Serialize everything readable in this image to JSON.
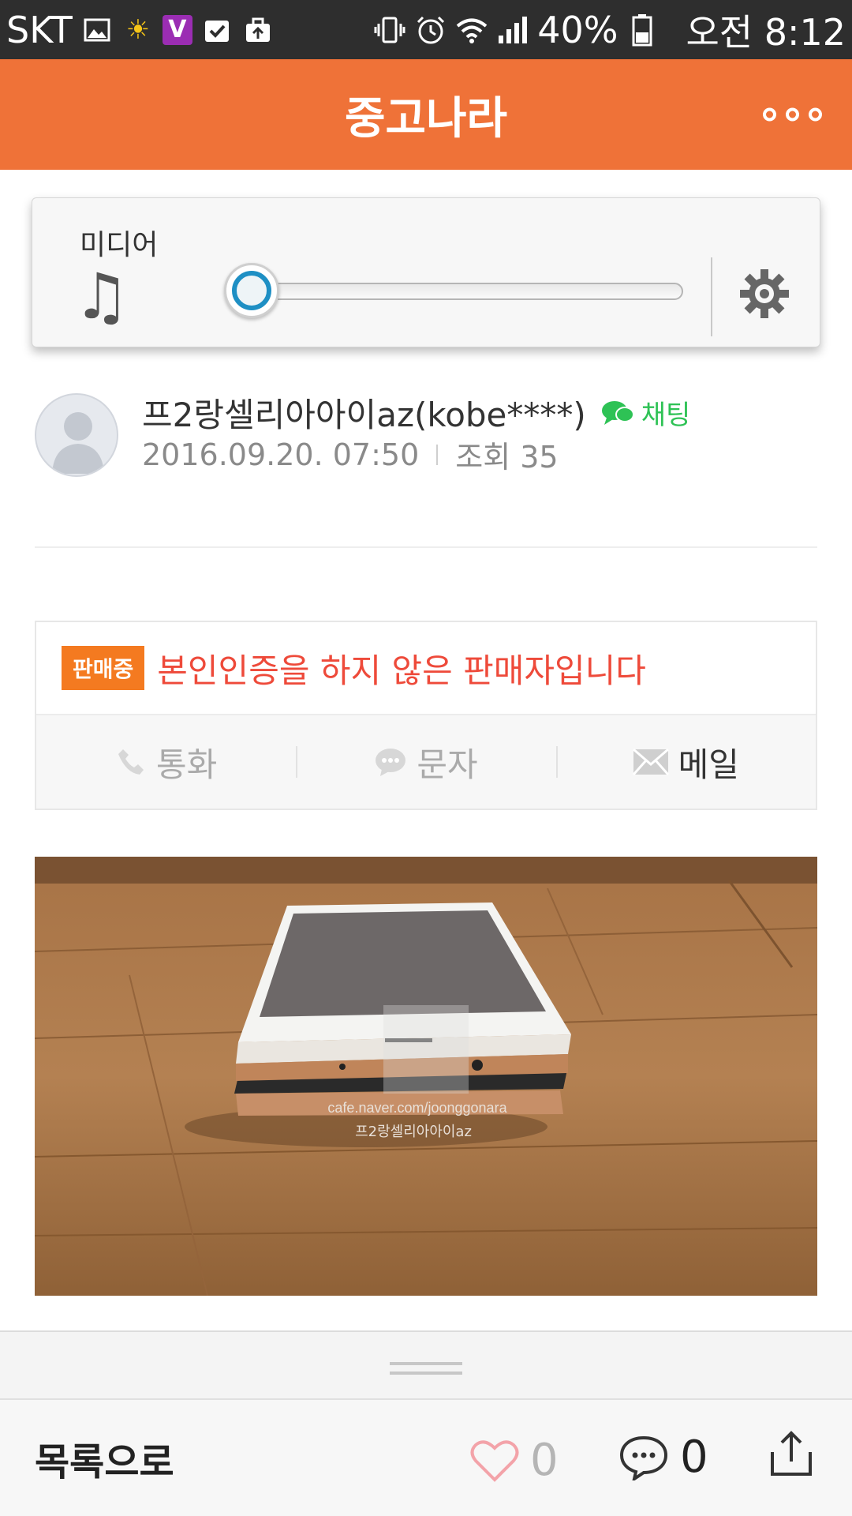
{
  "status_bar": {
    "carrier": "SKT",
    "battery": "40%",
    "time": "오전 8:12",
    "icons": [
      "gallery-icon",
      "sun-icon",
      "v-app-icon",
      "clipboard-check-icon",
      "bag-upload-icon",
      "vibrate-icon",
      "alarm-icon",
      "wifi-icon",
      "signal-icon",
      "battery-icon"
    ]
  },
  "header": {
    "title": "중고나라",
    "more_icon": "more-options-icon"
  },
  "volume": {
    "label": "미디어",
    "level": 0.0,
    "accent": "#1e8fc4"
  },
  "post": {
    "author": "프2랑셀리아아이az(kobe****)",
    "chat_label": "채팅",
    "date": "2016.09.20. 07:50",
    "views": "조회 35"
  },
  "seller": {
    "badge": "판매중",
    "warning": "본인인증을 하지 않은 판매자입니다",
    "actions": [
      {
        "label": "통화",
        "icon": "phone-icon"
      },
      {
        "label": "문자",
        "icon": "sms-icon"
      },
      {
        "label": "메일",
        "icon": "mail-icon"
      }
    ]
  },
  "photo": {
    "watermark_url": "cafe.naver.com/joonggonara",
    "watermark_name": "프2랑셀리아아이az"
  },
  "bottom": {
    "back_label": "목록으로",
    "likes": "0",
    "comments": "0"
  },
  "colors": {
    "header": "#ef7238",
    "warning": "#ee4a3a",
    "badge": "#f47a20",
    "chat": "#2ec255"
  }
}
